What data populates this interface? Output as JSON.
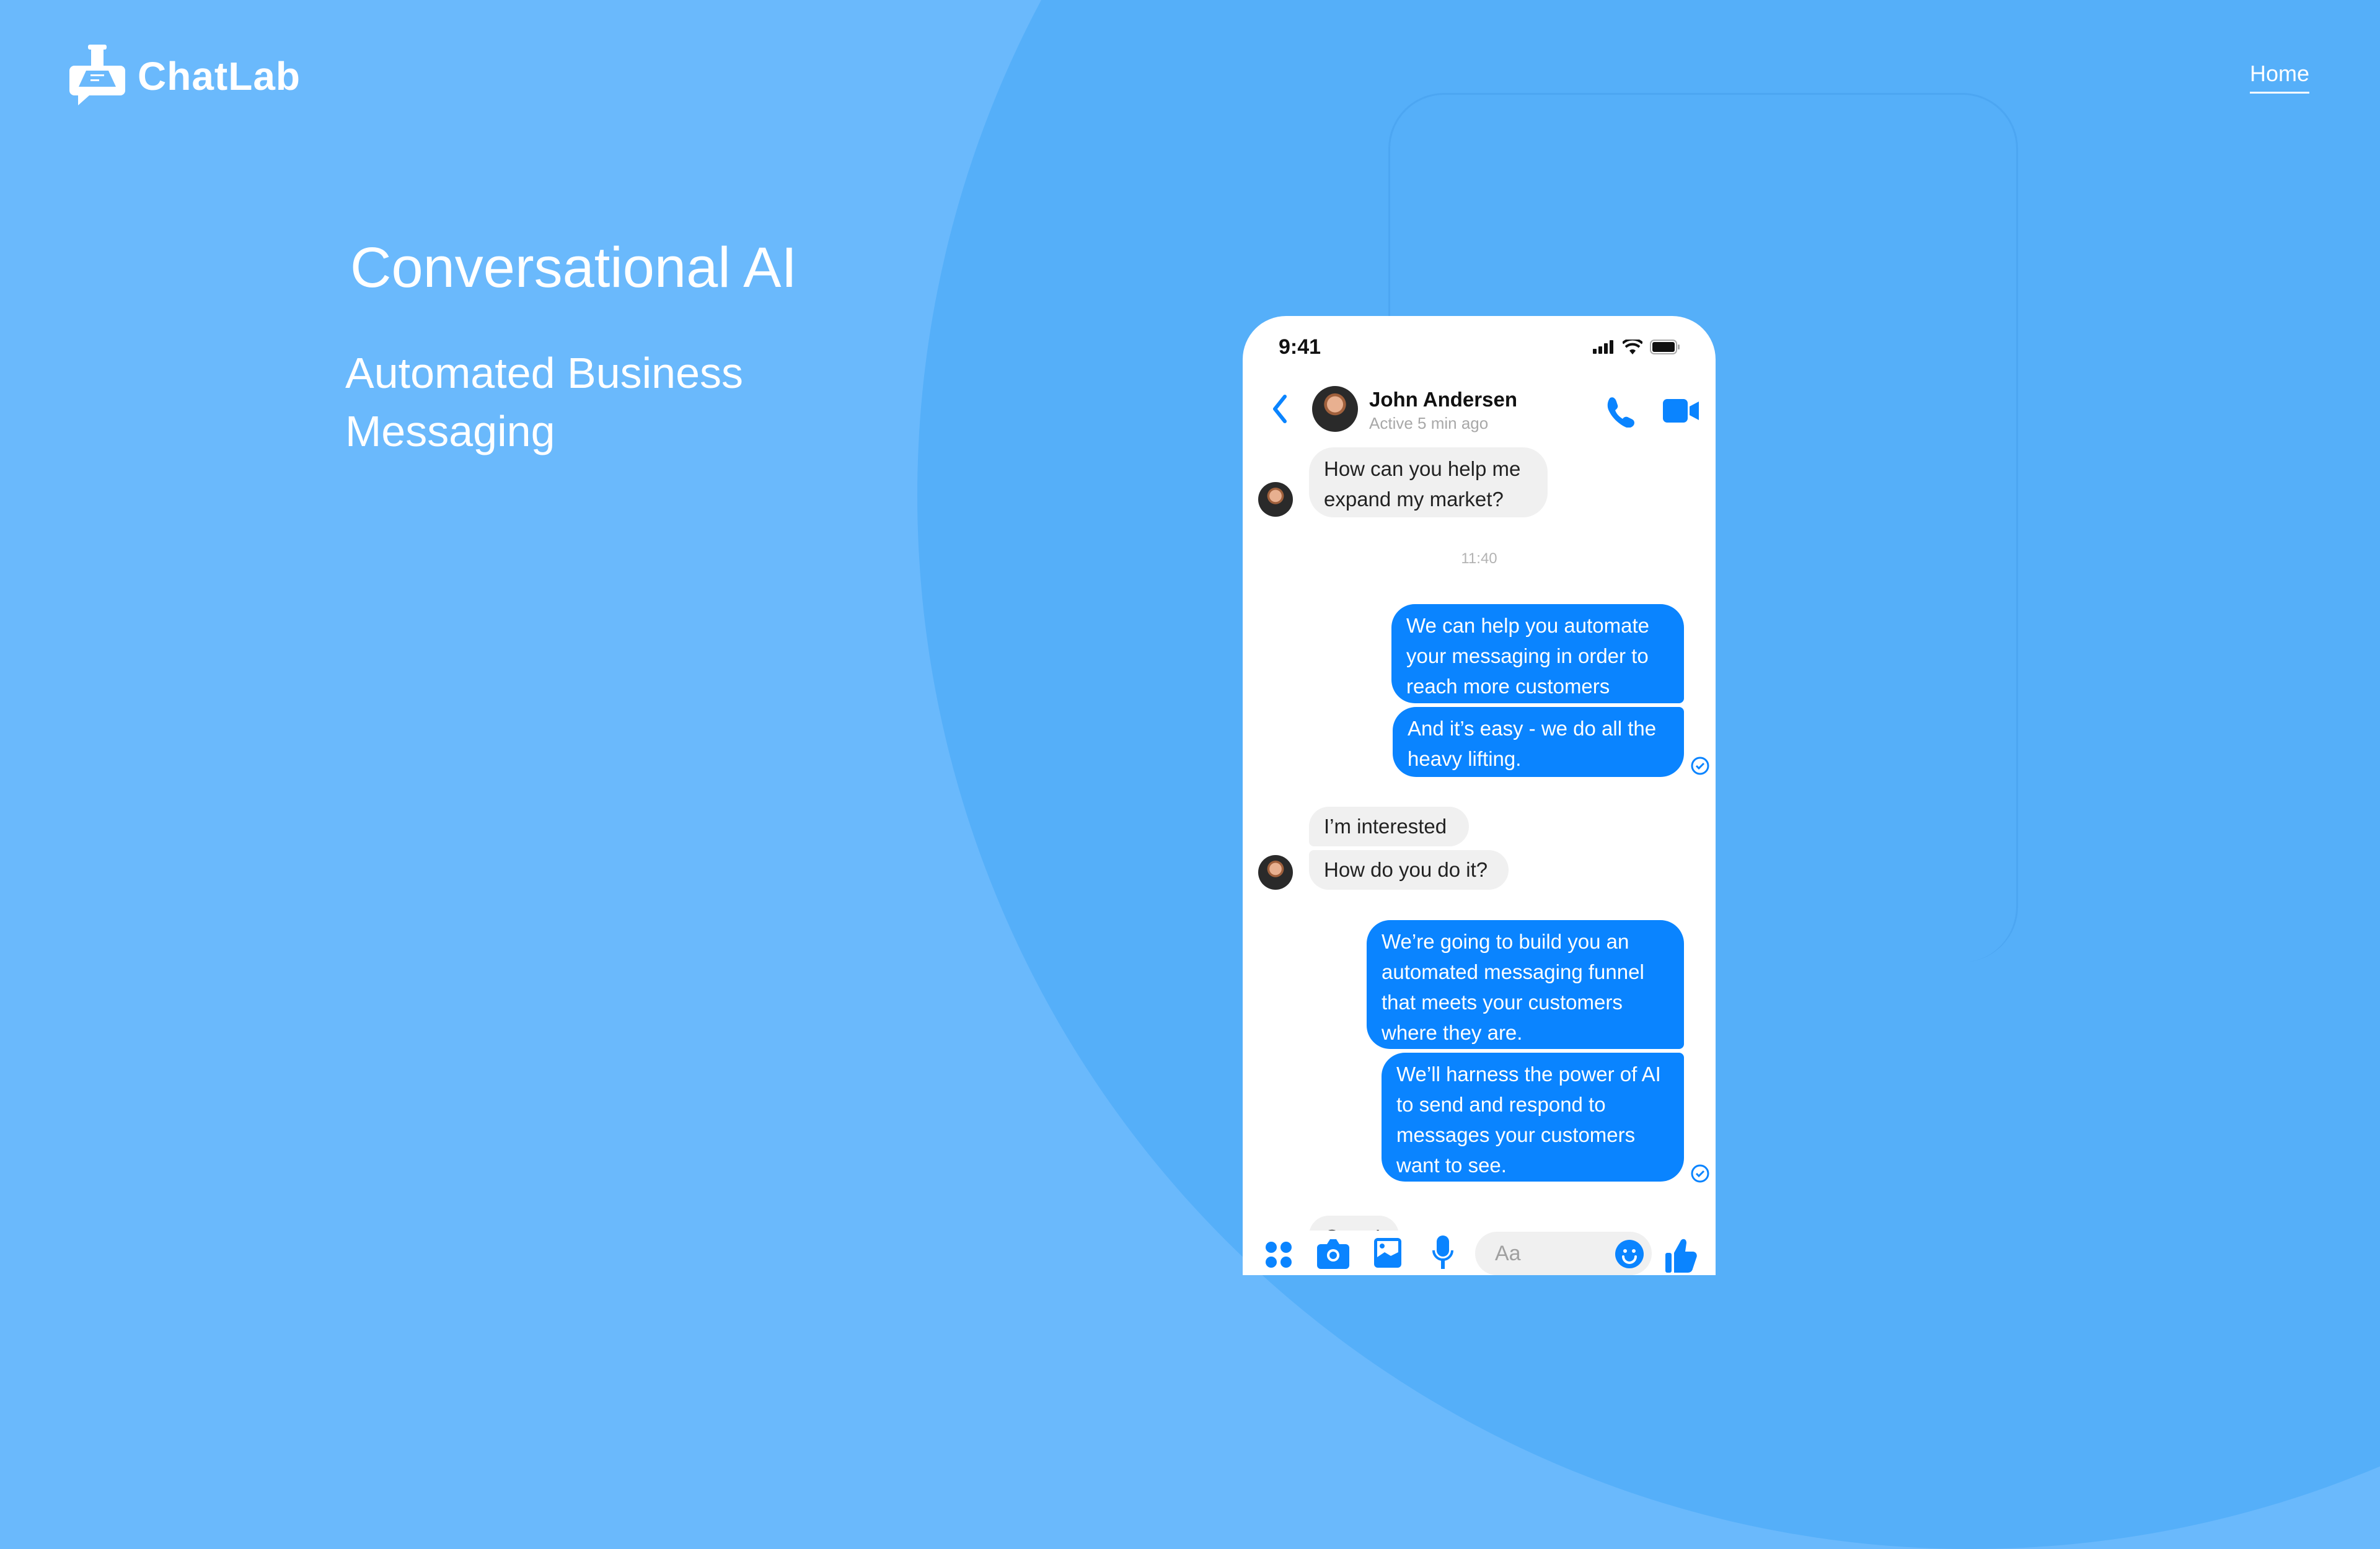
{
  "brand": {
    "name": "ChatLab"
  },
  "nav": {
    "home_label": "Home"
  },
  "hero": {
    "title": "Conversational AI",
    "subtitle": "Automated Business Messaging"
  },
  "phone": {
    "status_time": "9:41",
    "contact": {
      "name": "John Andersen",
      "status": "Active 5 min ago"
    },
    "timestamp": "11:40",
    "messages": [
      {
        "from": "contact",
        "text": "How can you help me expand my market?"
      },
      {
        "from": "me",
        "text": "We can help you automate your messaging in order to reach more customers"
      },
      {
        "from": "me",
        "text": "And it’s easy - we do all the heavy lifting."
      },
      {
        "from": "contact",
        "text": "I’m interested"
      },
      {
        "from": "contact",
        "text": "How do you do it?"
      },
      {
        "from": "me",
        "text": "We’re going to build you an automated messaging funnel that meets your customers where they are."
      },
      {
        "from": "me",
        "text": "We’ll harness the power of AI to send and respond to messages your customers want to see."
      },
      {
        "from": "contact",
        "text": "Great!"
      }
    ],
    "composer": {
      "placeholder": "Aa"
    }
  },
  "colors": {
    "background": "#6ab9fc",
    "circle": "#55aff9",
    "accent": "#0a84ff",
    "incoming_bubble": "#f0f0f0"
  }
}
